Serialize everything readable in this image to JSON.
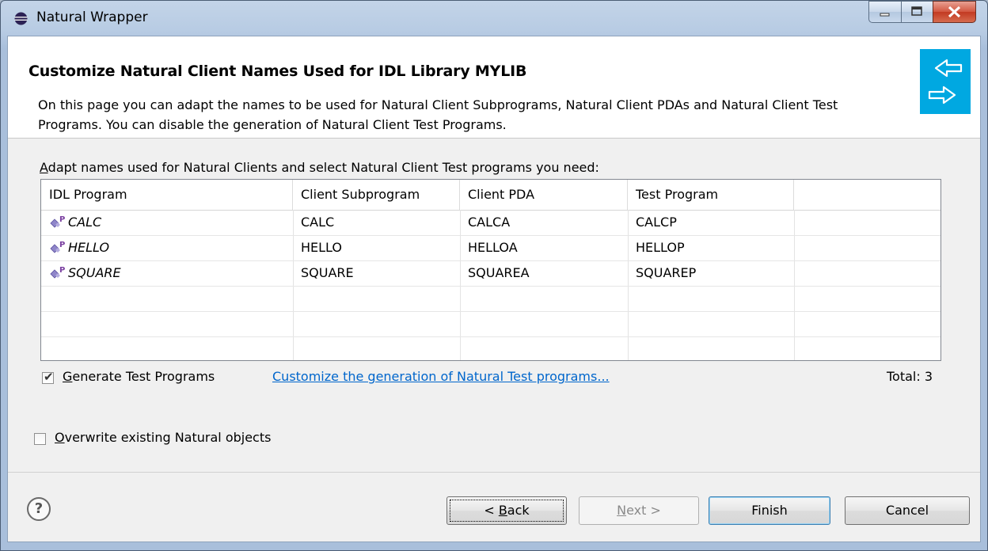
{
  "window": {
    "title": "Natural Wrapper"
  },
  "header": {
    "title": "Customize Natural Client Names Used for IDL Library MYLIB",
    "description": "On this page you can adapt the names to be used for Natural Client Subprograms, Natural Client PDAs and Natural Client Test Programs. You can disable the generation of Natural Client Test Programs."
  },
  "main": {
    "instruction": "Adapt names used for Natural Clients and select Natural Client Test programs you need:",
    "instruction_mnemonic": "A",
    "instruction_rest": "dapt names used for Natural Clients and select Natural Client Test programs you need:"
  },
  "table": {
    "columns": [
      "IDL Program",
      "Client Subprogram",
      "Client PDA",
      "Test Program"
    ],
    "rows": [
      {
        "idl_program": "CALC",
        "client_subprogram": "CALC",
        "client_pda": "CALCA",
        "test_program": "CALCP"
      },
      {
        "idl_program": "HELLO",
        "client_subprogram": "HELLO",
        "client_pda": "HELLOA",
        "test_program": "HELLOP"
      },
      {
        "idl_program": "SQUARE",
        "client_subprogram": "SQUARE",
        "client_pda": "SQUAREA",
        "test_program": "SQUAREP"
      }
    ],
    "icon_badge": "P"
  },
  "options": {
    "generate_test_programs": {
      "label_mnemonic": "G",
      "label_rest": "enerate Test Programs",
      "checked": true
    },
    "customize_link": "Customize the generation of Natural Test programs...",
    "total": "Total: 3",
    "overwrite": {
      "label_mnemonic": "O",
      "label_rest": "verwrite existing Natural objects",
      "checked": false
    }
  },
  "footer": {
    "help_icon": "?",
    "back": {
      "prefix": "< ",
      "mnemonic": "B",
      "rest": "ack"
    },
    "next": {
      "mnemonic": "N",
      "rest": "ext >"
    },
    "finish": "Finish",
    "cancel": "Cancel"
  },
  "colors": {
    "banner": "#00a8e1",
    "link": "#0066cc",
    "icon_purple": "#7a3fa0"
  }
}
